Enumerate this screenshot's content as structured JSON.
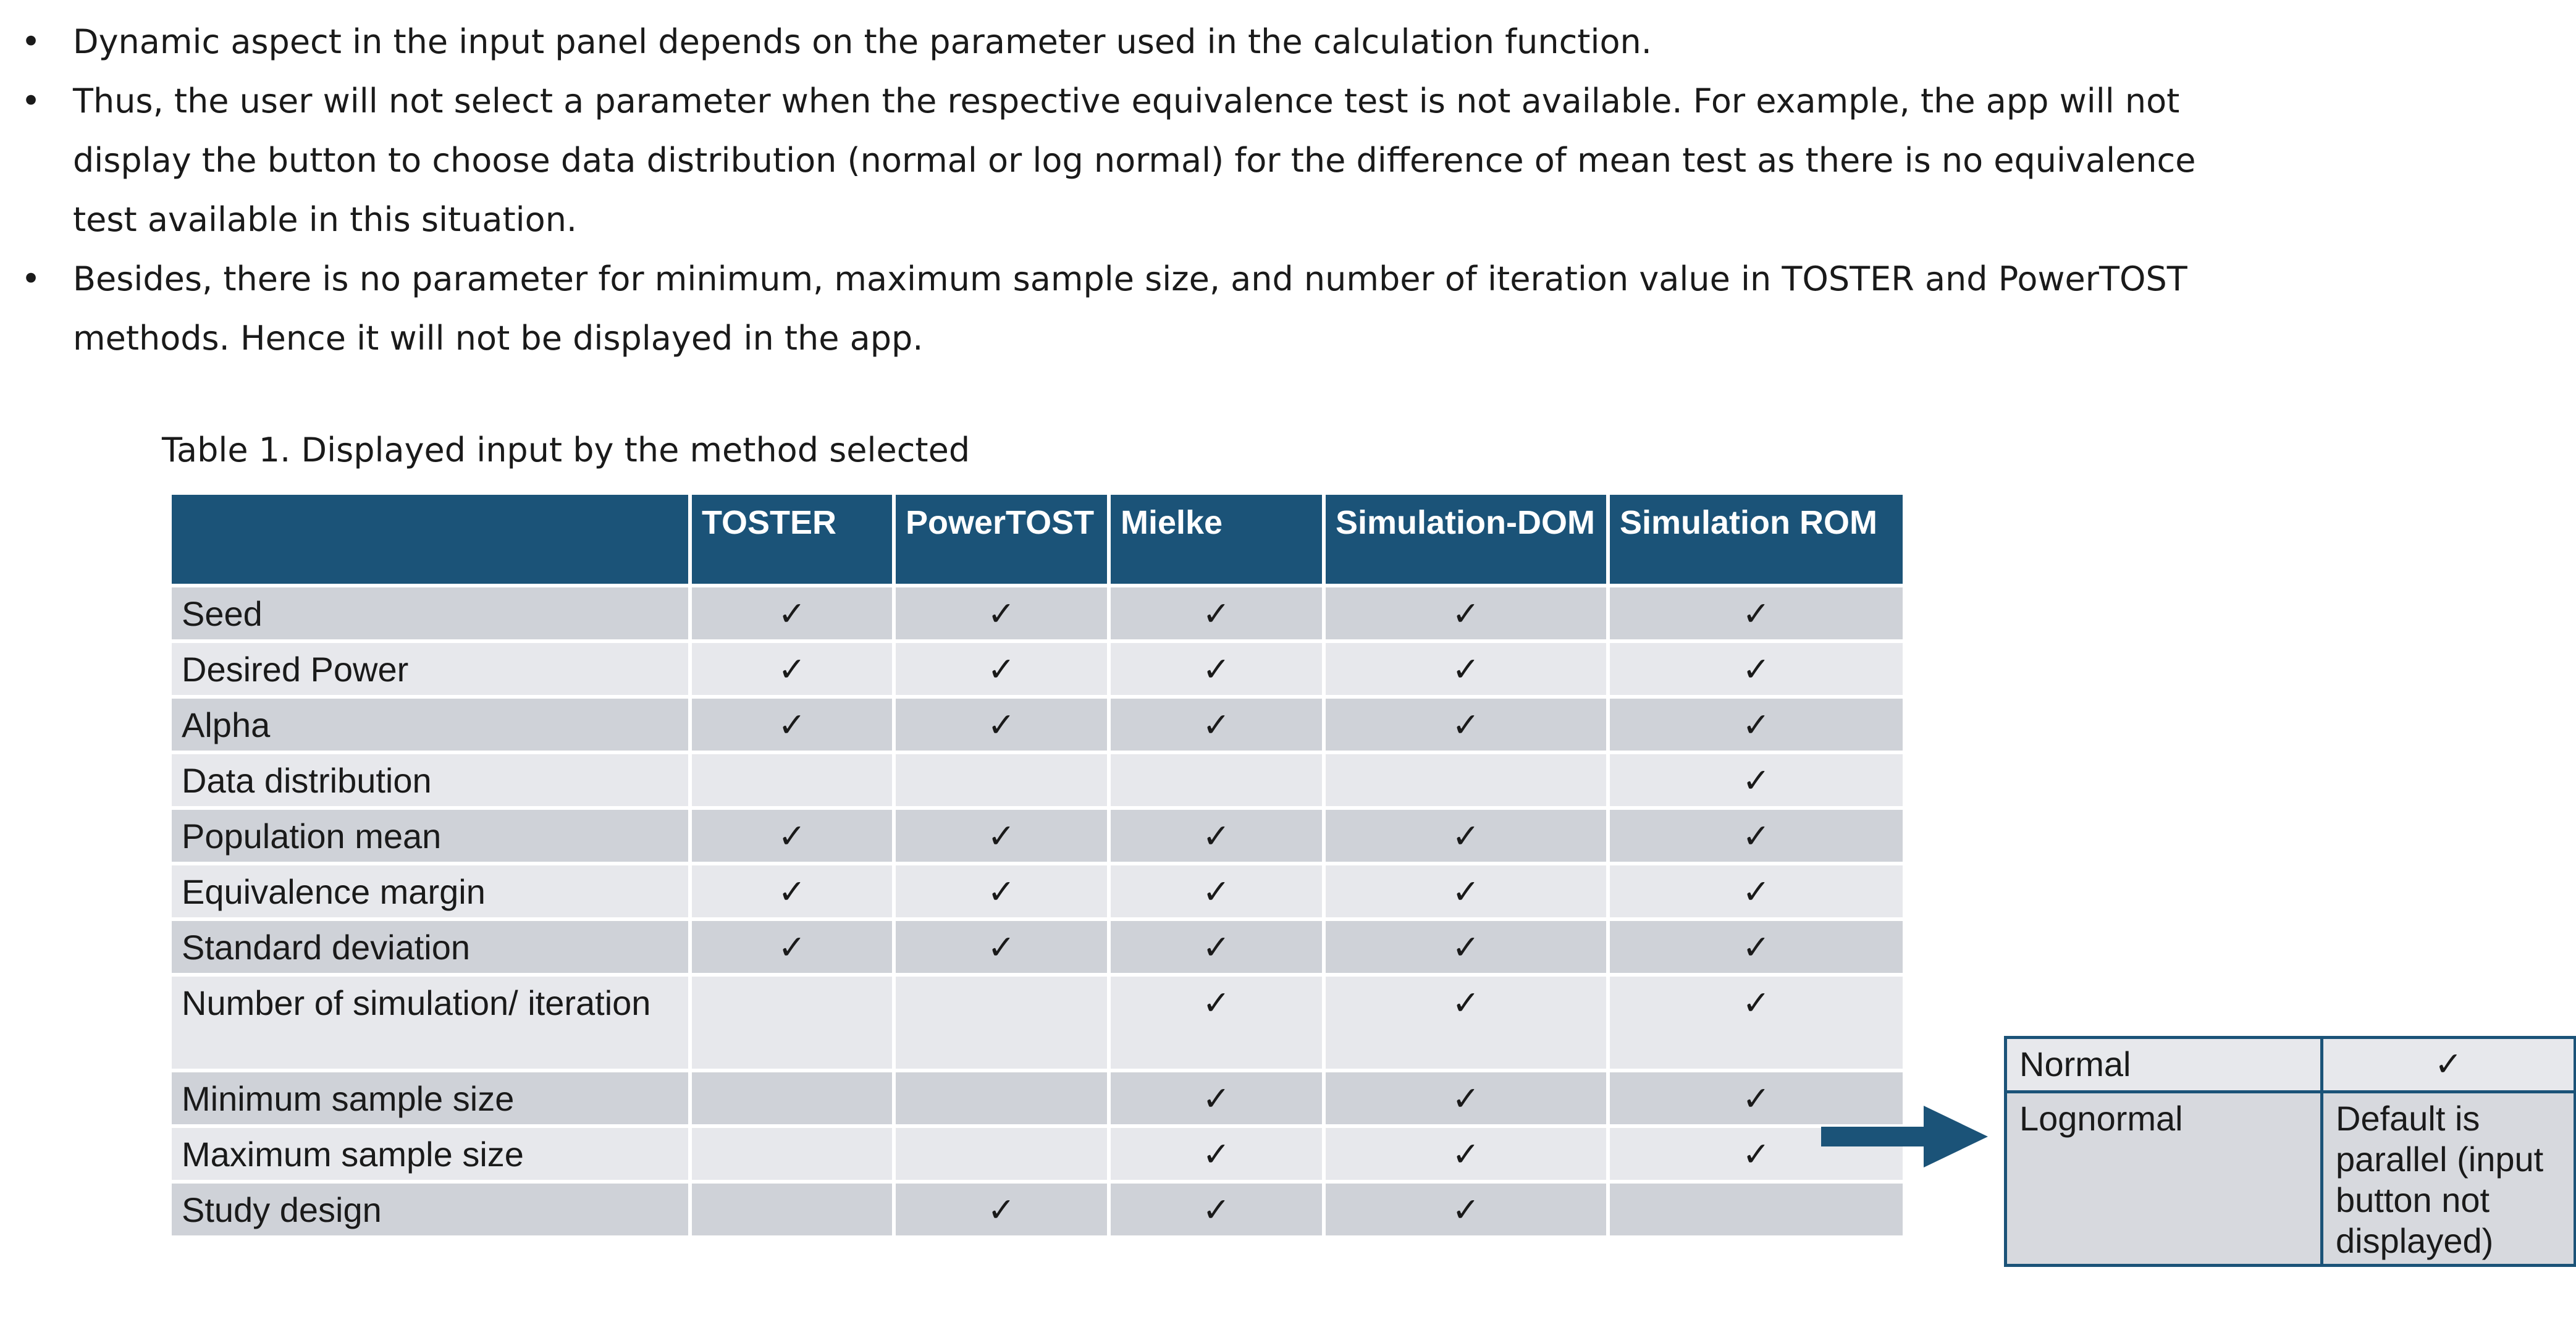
{
  "bullets": [
    "Dynamic aspect in the input panel depends on the parameter used in the calculation function.",
    "Thus, the user will not select a parameter when the respective equivalence test is not available. For example, the app will not display the button to choose data distribution (normal or log normal) for the difference of mean test as there is no equivalence test available in this situation.",
    "Besides, there is no parameter for minimum, maximum sample size, and number of iteration value in TOSTER and PowerTOST methods. Hence it will not be displayed in the app."
  ],
  "bullet_symbol": "•",
  "caption": "Table 1. Displayed input by the method selected",
  "table": {
    "corner_header": "",
    "columns": [
      "TOSTER",
      "PowerTOST",
      "Mielke",
      "Simulation-DOM",
      "Simulation ROM"
    ],
    "rows": [
      {
        "label": "Seed",
        "cells": [
          "✓",
          "✓",
          "✓",
          "✓",
          "✓"
        ]
      },
      {
        "label": "Desired Power",
        "cells": [
          "✓",
          "✓",
          "✓",
          "✓",
          "✓"
        ]
      },
      {
        "label": "Alpha",
        "cells": [
          "✓",
          "✓",
          "✓",
          "✓",
          "✓"
        ]
      },
      {
        "label": "Data distribution",
        "cells": [
          "",
          "",
          "",
          "",
          "✓"
        ]
      },
      {
        "label": "Population mean",
        "cells": [
          "✓",
          "✓",
          "✓",
          "✓",
          "✓"
        ]
      },
      {
        "label": "Equivalence margin",
        "cells": [
          "✓",
          "✓",
          "✓",
          "✓",
          "✓"
        ]
      },
      {
        "label": "Standard deviation",
        "cells": [
          "✓",
          "✓",
          "✓",
          "✓",
          "✓"
        ]
      },
      {
        "label": "Number of simulation/ iteration",
        "cells": [
          "",
          "",
          "✓",
          "✓",
          "✓"
        ]
      },
      {
        "label": "Minimum sample size",
        "cells": [
          "",
          "",
          "✓",
          "✓",
          "✓"
        ]
      },
      {
        "label": "Maximum sample size",
        "cells": [
          "",
          "",
          "✓",
          "✓",
          "✓"
        ]
      },
      {
        "label": "Study design",
        "cells": [
          "",
          "✓",
          "✓",
          "✓",
          ""
        ]
      }
    ]
  },
  "side_table": {
    "rows": [
      {
        "label": "Normal",
        "value": "✓"
      },
      {
        "label": "Lognormal",
        "value": "Default is parallel (input button not displayed)"
      }
    ]
  },
  "colors": {
    "header_bg": "#1b5378",
    "row_dark": "#cfd2d8",
    "row_light": "#e7e8ec",
    "arrow": "#1b5378"
  },
  "icons": {
    "arrow": "right-arrow-icon",
    "check": "check-mark"
  }
}
